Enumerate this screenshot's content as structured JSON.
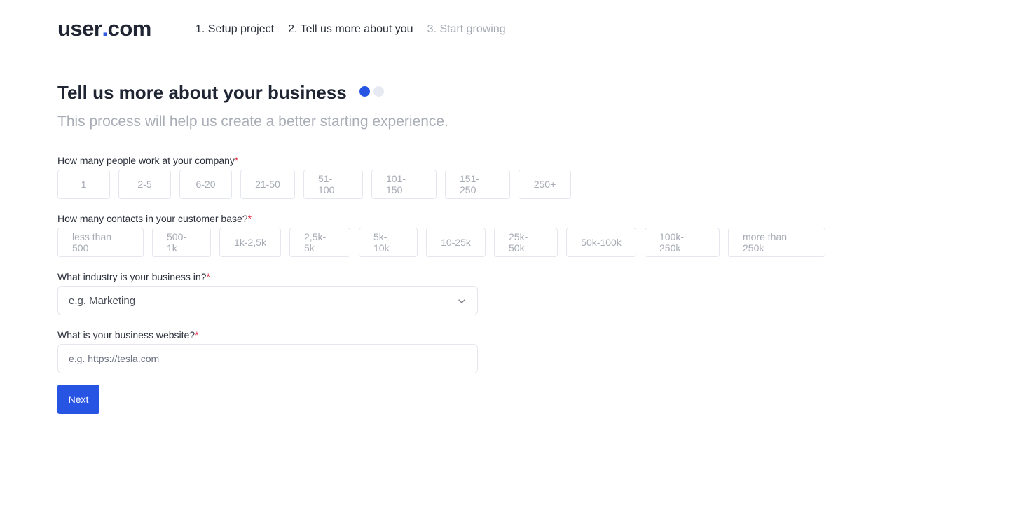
{
  "header": {
    "logo": {
      "left": "user",
      "dot": ".",
      "right": "com"
    },
    "steps": [
      {
        "label": "1. Setup project",
        "state": "done"
      },
      {
        "label": "2. Tell us more about you",
        "state": "active"
      },
      {
        "label": "3. Start growing",
        "state": "inactive"
      }
    ]
  },
  "main": {
    "title": "Tell us more about your business",
    "subtitle": "This process will help us create a better starting experience.",
    "progress": {
      "current": 1,
      "total": 2
    },
    "company_size": {
      "label": "How many people work at your company",
      "required_mark": "*",
      "options": [
        "1",
        "2-5",
        "6-20",
        "21-50",
        "51-100",
        "101-150",
        "151-250",
        "250+"
      ]
    },
    "contacts": {
      "label": "How many contacts in your customer base?",
      "required_mark": "*",
      "options": [
        "less than 500",
        "500-1k",
        "1k-2,5k",
        "2,5k-5k",
        "5k-10k",
        "10-25k",
        "25k-50k",
        "50k-100k",
        "100k-250k",
        "more than 250k"
      ]
    },
    "industry": {
      "label": "What industry is your business in?",
      "required_mark": "*",
      "placeholder": "e.g. Marketing"
    },
    "website": {
      "label": "What is your business website?",
      "required_mark": "*",
      "placeholder": "e.g. https://tesla.com",
      "value": ""
    },
    "next_label": "Next"
  },
  "colors": {
    "accent": "#2754e3",
    "required": "#e0344a",
    "muted_text": "#a9adb6"
  }
}
